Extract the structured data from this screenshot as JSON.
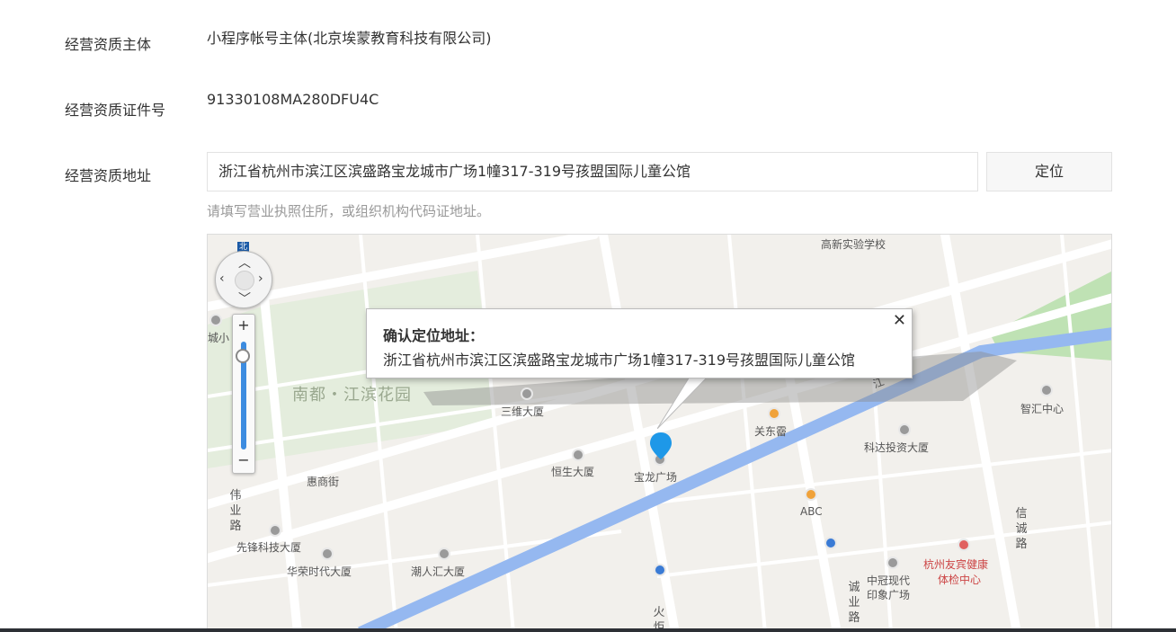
{
  "fields": {
    "entity": {
      "label": "经营资质主体",
      "value": "小程序帐号主体(北京埃蒙教育科技有限公司)"
    },
    "cert_no": {
      "label": "经营资质证件号",
      "value": "91330108MA280DFU4C"
    },
    "address": {
      "label": "经营资质地址",
      "value": "浙江省杭州市滨江区滨盛路宝龙城市广场1幢317-319号孩盟国际儿童公馆",
      "button": "定位",
      "hint": "请填写营业执照住所，或组织机构代码证地址。"
    }
  },
  "map": {
    "popup": {
      "title": "确认定位地址：",
      "address": "浙江省杭州市滨江区滨盛路宝龙城市广场1幢317-319号孩盟国际儿童公馆",
      "close": "✕"
    },
    "controls": {
      "north": "北",
      "zoom_in": "+",
      "zoom_out": "−"
    },
    "pois": {
      "school": "高新实验学校",
      "city": "城小",
      "park": "南都・江滨花园",
      "sanwei": "三维大厦",
      "hengsheng": "恒生大厦",
      "baolong": "宝龙广场",
      "guandongxian": "关东霤",
      "kedatouzi": "科达投资大厦",
      "zhihui": "智汇中心",
      "huishang": "惠商街",
      "xianfeng": "先锋科技大厦",
      "huarong": "华荣时代大厦",
      "chaoren": "潮人汇大厦",
      "abc": "ABC",
      "zhongguan1": "中冠现代",
      "zhongguan2": "印象广场",
      "youbin1": "杭州友宾健康",
      "youbin2": "体检中心",
      "weiye": "伟业路",
      "xincheng": "信诚路",
      "chengye": "诚业路",
      "huoju": "火炬",
      "jiang": "江"
    }
  }
}
